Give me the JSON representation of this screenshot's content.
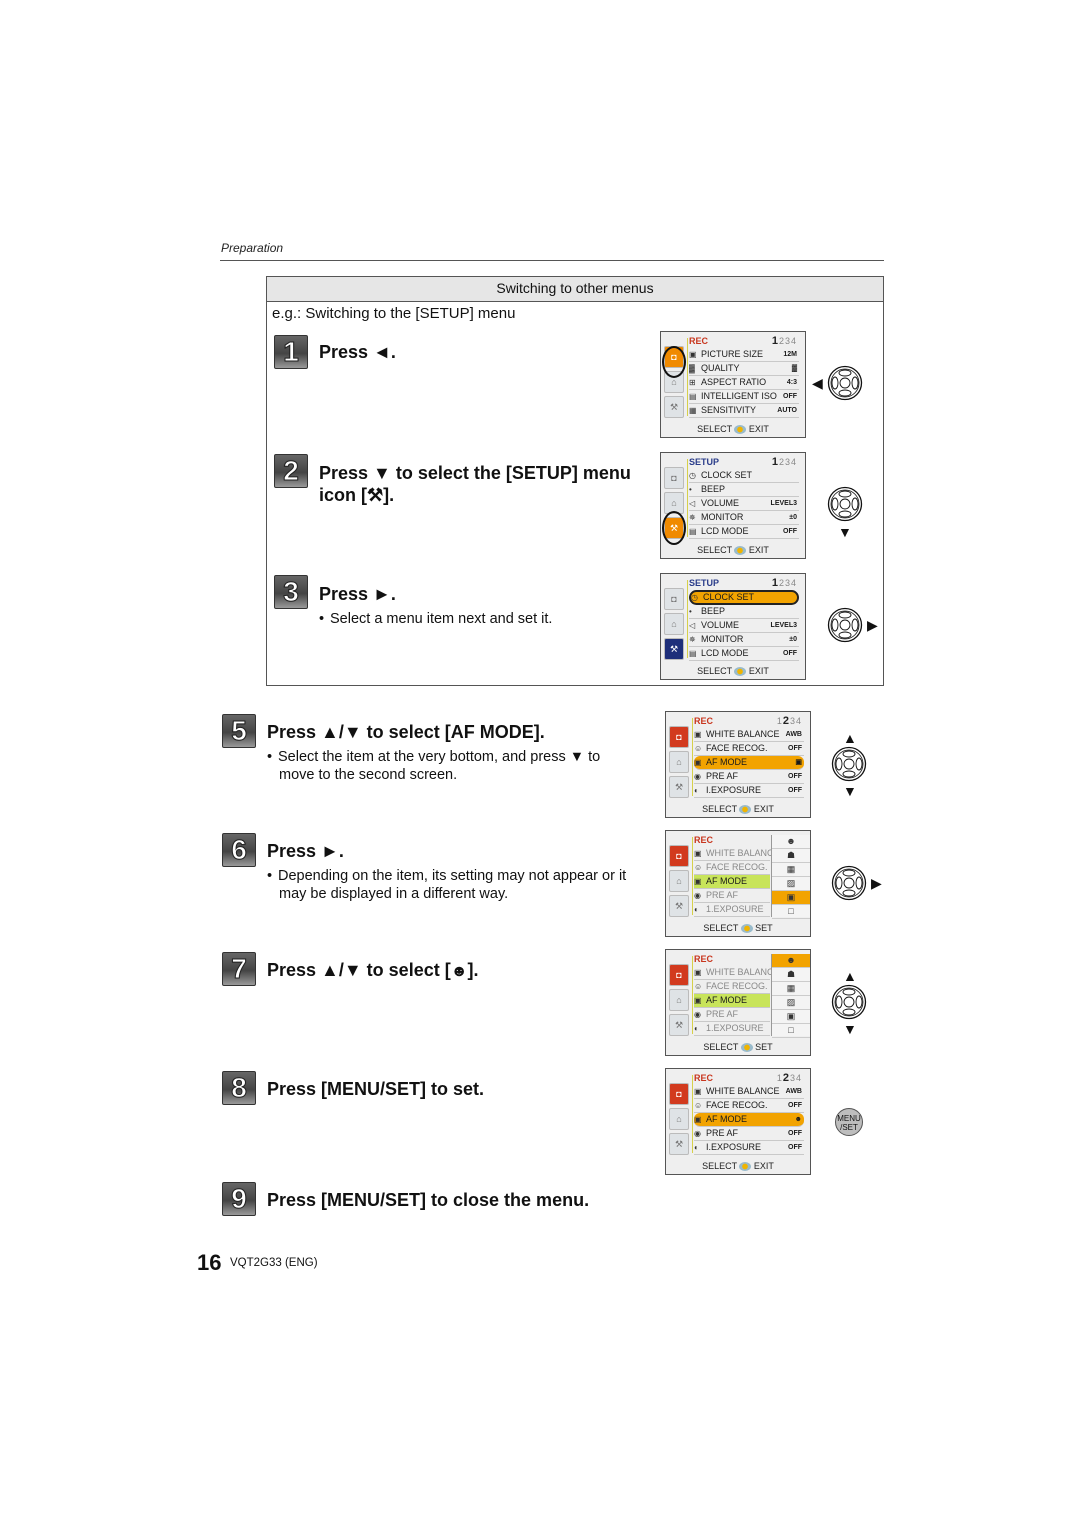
{
  "header": {
    "section": "Preparation"
  },
  "switch_box": {
    "title": "Switching to other menus",
    "example": "e.g.: Switching to the [SETUP] menu",
    "steps": [
      {
        "number": "1",
        "title": "Press ◄.",
        "bullets": [],
        "control": "left"
      },
      {
        "number": "2",
        "title": "Press ▼ to select the [SETUP] menu",
        "title_line2": "icon [⚒].",
        "bullets": [],
        "control": "down"
      },
      {
        "number": "3",
        "title": "Press ►.",
        "bullets": [
          "Select a menu item next and set it."
        ],
        "control": "right"
      }
    ]
  },
  "steps": [
    {
      "number": "5",
      "title": "Press ▲/▼ to select [AF MODE].",
      "bullets": [
        "Select the item at the very bottom, and press ▼ to",
        "move to the second screen."
      ],
      "control": "up-down"
    },
    {
      "number": "6",
      "title": "Press ►.",
      "bullets": [
        "Depending on the item, its setting may not appear or it",
        "may be displayed in a different way."
      ],
      "control": "right"
    },
    {
      "number": "7",
      "title": "Press ▲/▼ to select [",
      "title_icon": "face-detection",
      "title_end": "].",
      "bullets": [],
      "control": "up-down"
    },
    {
      "number": "8",
      "title": "Press [MENU/SET] to set.",
      "bullets": [],
      "control": "menu-set"
    },
    {
      "number": "9",
      "title": "Press [MENU/SET] to close the menu.",
      "bullets": []
    }
  ],
  "screens": [
    {
      "menu": "REC",
      "page": "1",
      "pages_rest": "234",
      "active_tab": "rec",
      "rows": [
        {
          "icon": "▣",
          "label": "PICTURE SIZE",
          "value": "12M"
        },
        {
          "icon": "▓",
          "label": "QUALITY",
          "value": "▓"
        },
        {
          "icon": "⊞",
          "label": "ASPECT RATIO",
          "value": "4:3"
        },
        {
          "icon": "▤",
          "label": "INTELLIGENT ISO",
          "value": "OFF"
        },
        {
          "icon": "▦",
          "label": "SENSITIVITY",
          "value": "AUTO"
        }
      ],
      "footer_left": "SELECT",
      "footer_right": "EXIT"
    },
    {
      "menu": "SETUP",
      "page": "1",
      "pages_rest": "234",
      "active_tab": "setup",
      "rows": [
        {
          "icon": "◷",
          "label": "CLOCK SET",
          "value": ""
        },
        {
          "icon": "•",
          "label": "BEEP",
          "value": ""
        },
        {
          "icon": "◁",
          "label": "VOLUME",
          "value": "LEVEL3"
        },
        {
          "icon": "✵",
          "label": "MONITOR",
          "value": "±0"
        },
        {
          "icon": "▤",
          "label": "LCD MODE",
          "value": "OFF"
        }
      ],
      "footer_left": "SELECT",
      "footer_right": "EXIT"
    },
    {
      "menu": "SETUP",
      "page": "1",
      "pages_rest": "234",
      "active_tab": "setup",
      "rows": [
        {
          "icon": "◷",
          "label": "CLOCK SET",
          "value": ""
        },
        {
          "icon": "•",
          "label": "BEEP",
          "value": ""
        },
        {
          "icon": "◁",
          "label": "VOLUME",
          "value": "LEVEL3"
        },
        {
          "icon": "✵",
          "label": "MONITOR",
          "value": "±0"
        },
        {
          "icon": "▤",
          "label": "LCD MODE",
          "value": "OFF"
        }
      ],
      "footer_left": "SELECT",
      "footer_right": "EXIT"
    },
    {
      "menu": "REC",
      "page": "2",
      "pages_rest": "34",
      "active_tab": "rec",
      "rows": [
        {
          "icon": "▣",
          "label": "WHITE BALANCE",
          "value": "AWB"
        },
        {
          "icon": "☺",
          "label": "FACE RECOG.",
          "value": "OFF"
        },
        {
          "icon": "▣",
          "label": "AF MODE",
          "value": "▣"
        },
        {
          "icon": "◉",
          "label": "PRE AF",
          "value": "OFF"
        },
        {
          "icon": "◐",
          "label": "I.EXPOSURE",
          "value": "OFF"
        }
      ],
      "footer_left": "SELECT",
      "footer_right": "EXIT"
    },
    {
      "menu": "REC",
      "active_tab": "rec",
      "rows": [
        {
          "icon": "▣",
          "label": "WHITE BALANC",
          "value": ""
        },
        {
          "icon": "☺",
          "label": "FACE RECOG.",
          "value": ""
        },
        {
          "icon": "▣",
          "label": "AF MODE",
          "value": ""
        },
        {
          "icon": "◉",
          "label": "PRE AF",
          "value": ""
        },
        {
          "icon": "◐",
          "label": "1.EXPOSURE",
          "value": ""
        }
      ],
      "popup": [
        "☻",
        "☗",
        "▦",
        "▨",
        "▣",
        "□"
      ],
      "popup_selected": 4,
      "footer_left": "SELECT",
      "footer_right": "SET"
    },
    {
      "menu": "REC",
      "active_tab": "rec",
      "rows": [
        {
          "icon": "▣",
          "label": "WHITE BALANC",
          "value": ""
        },
        {
          "icon": "☺",
          "label": "FACE RECOG.",
          "value": ""
        },
        {
          "icon": "▣",
          "label": "AF MODE",
          "value": ""
        },
        {
          "icon": "◉",
          "label": "PRE AF",
          "value": ""
        },
        {
          "icon": "◐",
          "label": "1.EXPOSURE",
          "value": ""
        }
      ],
      "popup": [
        "☻",
        "☗",
        "▦",
        "▨",
        "▣",
        "□"
      ],
      "popup_selected": 0,
      "footer_left": "SELECT",
      "footer_right": "SET"
    },
    {
      "menu": "REC",
      "page": "2",
      "pages_rest": "34",
      "active_tab": "rec",
      "rows": [
        {
          "icon": "▣",
          "label": "WHITE BALANCE",
          "value": "AWB"
        },
        {
          "icon": "☺",
          "label": "FACE RECOG.",
          "value": "OFF"
        },
        {
          "icon": "▣",
          "label": "AF MODE",
          "value": "☻"
        },
        {
          "icon": "◉",
          "label": "PRE AF",
          "value": "OFF"
        },
        {
          "icon": "◐",
          "label": "I.EXPOSURE",
          "value": "OFF"
        }
      ],
      "footer_left": "SELECT",
      "footer_right": "EXIT"
    }
  ],
  "controls": {
    "menu_set_label_1": "MENU",
    "menu_set_label_2": "/SET",
    "arrow_left": "◀",
    "arrow_right": "▶",
    "arrow_up": "▲",
    "arrow_down": "▼"
  },
  "footer": {
    "page_number": "16",
    "doc_code": "VQT2G33 (ENG)"
  }
}
